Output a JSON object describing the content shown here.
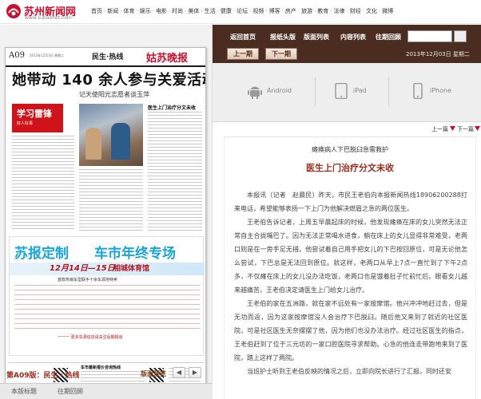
{
  "site": {
    "logo_text": "苏州新闻网",
    "logo_url_text": "www.subaonet.com",
    "nav": [
      "首页",
      "新闻",
      "体育",
      "娱乐",
      "电影",
      "时尚",
      "美体",
      "生活",
      "健康",
      "论坛",
      "视频",
      "博客",
      "房产",
      "旅游",
      "教育",
      "法律",
      "财经",
      "文化",
      "微博"
    ]
  },
  "page": {
    "number": "A09",
    "date_line": "2013年12月3日 星期二",
    "section": "民生·热线",
    "masthead": "姑苏晚报",
    "headline": "她带动 140 余人参与关爱活动",
    "subheadline": "记天使阳光志愿者谈玉萍",
    "stamp_title": "学习雷锋",
    "stamp_sub": "好人好事",
    "side_head": "医生上门治疗分文未收",
    "ad": {
      "title_left": "苏报定制",
      "title_right": "车市年终专场",
      "dates": "12月14日—15日",
      "venue": "相城体育馆",
      "line": "首款热销车型联手十余车源地特卖",
      "footer": "一一一 更多车源信息请关注后期报道"
    },
    "bottom_title": "车市最新报价咨询热线"
  },
  "left_footer": {
    "page_label": "第A09版：民生・热线",
    "prev_label": "版面预览",
    "prev_btn": "◀",
    "next_btn": "▶",
    "tabs": [
      "本版标题",
      "往期回顾"
    ]
  },
  "toolbar": {
    "items": [
      "返回首页",
      "报纸头版",
      "版面列表",
      "内容列表",
      "往期回顾"
    ],
    "search_placeholder": "",
    "prev_issue": "上一期",
    "next_issue": "下一期",
    "date": "2013年12月03日 星期二"
  },
  "apps": [
    {
      "label": "Android",
      "icon": "android-icon"
    },
    {
      "label": "iPad",
      "icon": "ipad-icon"
    },
    {
      "label": "iPhone",
      "icon": "iphone-icon"
    }
  ],
  "article_nav": {
    "prev": "上一篇",
    "next": "下一篇"
  },
  "article": {
    "kicker": "瘫痪病人下巴脱臼急需救护",
    "title": "医生上门治疗分文未收",
    "paragraphs": [
      "本报讯（记者　赵晨民）昨天，市民王老伯向本报新闻热线18906200288打来电话，希望能够表扬一下上门为他解决燃眉之急的两位医生。",
      "王老伯告诉记者，上周五早晨起床的时候，他发现瘫痪在床的女儿突然无法正常自主合拢嘴巴了。因为无法正常喝水进食，躺在床上的女儿显得非常难受，老两口则是在一旁手足无措。他尝试着自己用手把女儿的下巴按回原位，可是无论他怎么尝试，下巴总是无法回到原位。就这样，老两口从早上7点一直忙到了下午2点多，不仅瘫在床上的女儿没办法吃饭，老两口也是饿着肚子忙前忙后。眼看女儿越来越痛苦，王老伯决定请医生上门给女儿治疗。",
      "王老伯的家在五洲路，就在家不远处有一家按摩馆。他兴冲冲地赶过去，但是无功而返，因为这家按摩馆没人会治疗下巴脱臼。随后他又来到了就近的社区医院，可是社区医生无奈摆摆了他，因为他们也没办法治疗。经过社区医生的指点，王老伯赶到了位于三元坊的一家口腔医院寻求帮助。心急的他连走带跑地来到了医院，踏上这样了两院。",
      "当班护士听到王老伯反映的情况之后，立即向院长进行了汇报，同时还安"
    ]
  },
  "colors": {
    "brand_red": "#c8102e",
    "toolbar_bg": "#4a2c21",
    "title_red": "#a0281e",
    "ad_blue": "#17a4d8"
  }
}
